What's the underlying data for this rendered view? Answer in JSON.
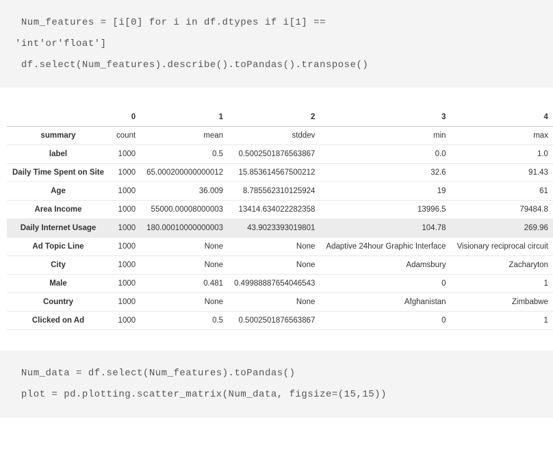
{
  "code_top": " Num_features = [i[0] for i in df.dtypes if i[1] ==\n'int'or'float']\n df.select(Num_features).describe().toPandas().transpose()",
  "code_bottom": " Num_data = df.select(Num_features).toPandas()\n plot = pd.plotting.scatter_matrix(Num_data, figsize=(15,15))",
  "table": {
    "columns": [
      "0",
      "1",
      "2",
      "3",
      "4"
    ],
    "summary_labels": [
      "count",
      "mean",
      "stddev",
      "min",
      "max"
    ],
    "rows": [
      {
        "name": "summary",
        "cells": [
          "count",
          "mean",
          "stddev",
          "min",
          "max"
        ],
        "is_summary": true
      },
      {
        "name": "label",
        "cells": [
          "1000",
          "0.5",
          "0.5002501876563867",
          "0.0",
          "1.0"
        ]
      },
      {
        "name": "Daily Time Spent on Site",
        "cells": [
          "1000",
          "65.000200000000012",
          "15.853614567500212",
          "32.6",
          "91.43"
        ]
      },
      {
        "name": "Age",
        "cells": [
          "1000",
          "36.009",
          "8.785562310125924",
          "19",
          "61"
        ]
      },
      {
        "name": "Area Income",
        "cells": [
          "1000",
          "55000.00008000003",
          "13414.634022282358",
          "13996.5",
          "79484.8"
        ]
      },
      {
        "name": "Daily Internet Usage",
        "cells": [
          "1000",
          "180.00010000000003",
          "43.9023393019801",
          "104.78",
          "269.96"
        ],
        "hl": true
      },
      {
        "name": "Ad Topic Line",
        "cells": [
          "1000",
          "None",
          "None",
          "Adaptive 24hour Graphic Interface",
          "Visionary reciprocal circuit"
        ]
      },
      {
        "name": "City",
        "cells": [
          "1000",
          "None",
          "None",
          "Adamsbury",
          "Zacharyton"
        ]
      },
      {
        "name": "Male",
        "cells": [
          "1000",
          "0.481",
          "0.49988887654046543",
          "0",
          "1"
        ]
      },
      {
        "name": "Country",
        "cells": [
          "1000",
          "None",
          "None",
          "Afghanistan",
          "Zimbabwe"
        ]
      },
      {
        "name": "Clicked on Ad",
        "cells": [
          "1000",
          "0.5",
          "0.5002501876563867",
          "0",
          "1"
        ]
      }
    ]
  }
}
